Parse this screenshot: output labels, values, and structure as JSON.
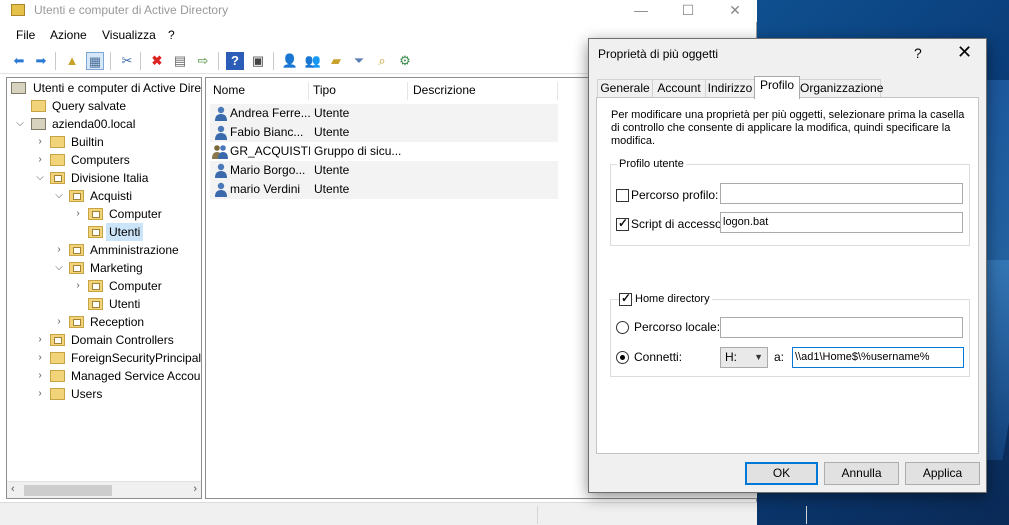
{
  "window": {
    "title": "Utenti e computer di Active Directory",
    "minimize": "—",
    "maximize": "☐",
    "close": "✕"
  },
  "menu": [
    "File",
    "Azione",
    "Visualizza",
    "?"
  ],
  "toolbar_icons": [
    "back-arrow-icon",
    "forward-arrow-icon",
    "up-folder-icon",
    "show-tree-icon",
    "cut-icon",
    "delete-icon",
    "properties-icon",
    "export-icon",
    "help-icon",
    "console-icon",
    "new-user-icon",
    "new-group-icon",
    "new-ou-icon",
    "filter-icon",
    "find-icon",
    "delegate-icon"
  ],
  "tree": {
    "root": "Utenti e computer di Active Directory",
    "items": [
      {
        "label": "Query salvate"
      },
      {
        "label": "azienda00.local"
      },
      {
        "label": "Builtin"
      },
      {
        "label": "Computers"
      },
      {
        "label": "Divisione Italia"
      },
      {
        "label": "Acquisti"
      },
      {
        "label": "Computer"
      },
      {
        "label": "Utenti"
      },
      {
        "label": "Amministrazione"
      },
      {
        "label": "Marketing"
      },
      {
        "label": "Computer"
      },
      {
        "label": "Utenti"
      },
      {
        "label": "Reception"
      },
      {
        "label": "Domain Controllers"
      },
      {
        "label": "ForeignSecurityPrincipals"
      },
      {
        "label": "Managed Service Accounts"
      },
      {
        "label": "Users"
      }
    ]
  },
  "list": {
    "columns": [
      "Nome",
      "Tipo",
      "Descrizione"
    ],
    "rows": [
      {
        "name": "Andrea Ferre...",
        "type": "Utente",
        "icon": "user-icon"
      },
      {
        "name": "Fabio Bianc...",
        "type": "Utente",
        "icon": "user-icon"
      },
      {
        "name": "GR_ACQUISTI",
        "type": "Gruppo di sicu...",
        "icon": "group-icon"
      },
      {
        "name": "Mario Borgo...",
        "type": "Utente",
        "icon": "user-icon"
      },
      {
        "name": "mario Verdini",
        "type": "Utente",
        "icon": "user-icon"
      }
    ]
  },
  "dialog": {
    "title": "Proprietà di più oggetti",
    "help": "?",
    "close": "✕",
    "tabs": [
      "Generale",
      "Account",
      "Indirizzo",
      "Profilo",
      "Organizzazione"
    ],
    "active_tab": "Profilo",
    "description": "Per modificare una proprietà per più oggetti, selezionare prima la casella di controllo che consente di applicare la modifica, quindi specificare la modifica.",
    "profile_group": {
      "title": "Profilo utente",
      "profile_path_label": "Percorso profilo:",
      "profile_path_checked": false,
      "profile_path_value": "",
      "logon_script_label": "Script di accesso:",
      "logon_script_checked": true,
      "logon_script_value": "logon.bat"
    },
    "home_group": {
      "title": "Home directory",
      "checked": true,
      "local_path_label": "Percorso locale:",
      "local_path_value": "",
      "connect_label": "Connetti:",
      "drive": "H:",
      "to_label": "a:",
      "path_value": "\\\\ad1\\Home$\\%username%"
    },
    "buttons": {
      "ok": "OK",
      "cancel": "Annulla",
      "apply": "Applica"
    }
  }
}
